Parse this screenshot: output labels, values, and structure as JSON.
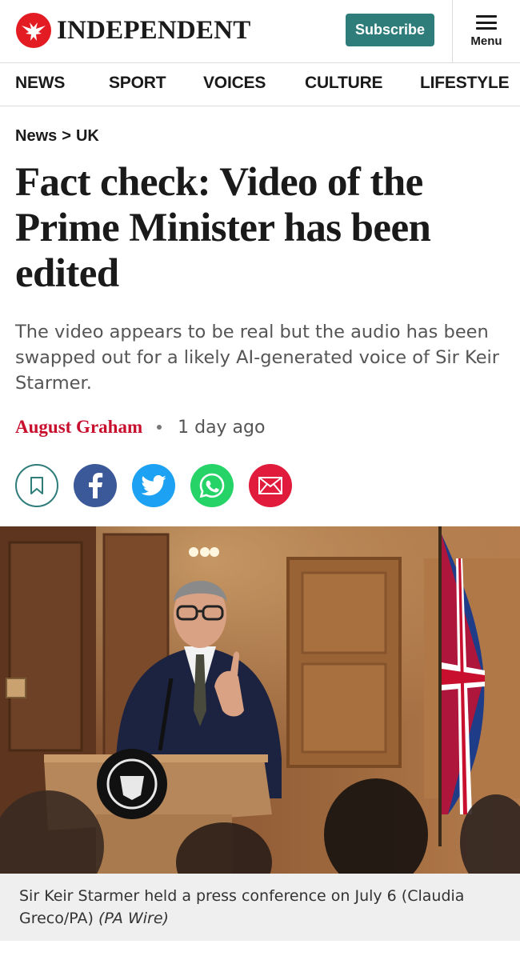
{
  "header": {
    "brand": "INDEPENDENT",
    "subscribe_label": "Subscribe",
    "menu_label": "Menu"
  },
  "nav": {
    "items": [
      "NEWS",
      "SPORT",
      "VOICES",
      "CULTURE",
      "LIFESTYLE"
    ]
  },
  "breadcrumb": {
    "section": "News",
    "separator": ">",
    "subsection": "UK"
  },
  "article": {
    "headline": "Fact check: Video of the Prime Minister has been edited",
    "standfirst": "The video appears to be real but the audio has been swapped out for a likely AI-generated voice of Sir Keir Starmer.",
    "author": "August Graham",
    "published": "1 day ago",
    "share_icons": [
      "bookmark-icon",
      "facebook-icon",
      "twitter-icon",
      "whatsapp-icon",
      "email-icon"
    ],
    "image": {
      "caption": "Sir Keir Starmer held a press conference on July 6 (Claudia Greco/PA)",
      "credit": "(PA Wire)"
    }
  },
  "colors": {
    "brand_red": "#e31b23",
    "subscribe_teal": "#2e7d7b",
    "author_red": "#c8102e",
    "facebook": "#3b5998",
    "twitter": "#1da1f2",
    "whatsapp": "#25d366",
    "email": "#e01b3c"
  }
}
